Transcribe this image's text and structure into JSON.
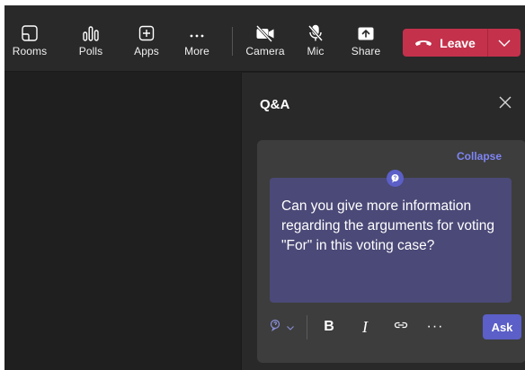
{
  "toolbar": {
    "buttons": [
      {
        "label": "Rooms",
        "icon": "rooms-icon"
      },
      {
        "label": "Polls",
        "icon": "polls-icon"
      },
      {
        "label": "Apps",
        "icon": "apps-icon"
      },
      {
        "label": "More",
        "icon": "more-icon"
      },
      {
        "label": "Camera",
        "icon": "camera-off-icon"
      },
      {
        "label": "Mic",
        "icon": "mic-off-icon"
      },
      {
        "label": "Share",
        "icon": "share-icon"
      }
    ],
    "leave": {
      "label": "Leave",
      "icon": "phone-hangup-icon"
    }
  },
  "panel": {
    "title": "Q&A",
    "collapse_label": "Collapse",
    "question_text": "Can you give more information regarding the arguments for voting \"For\" in this voting case?",
    "ask_label": "Ask",
    "format_bold": "B",
    "format_italic": "I",
    "more_options": "···"
  },
  "colors": {
    "frame_bg": "#1f1f1f",
    "toolbar_bg": "#292929",
    "leave_red": "#c4314b",
    "accent": "#5b5fc7",
    "link": "#7f85f5",
    "input_bg": "#4b4977"
  }
}
